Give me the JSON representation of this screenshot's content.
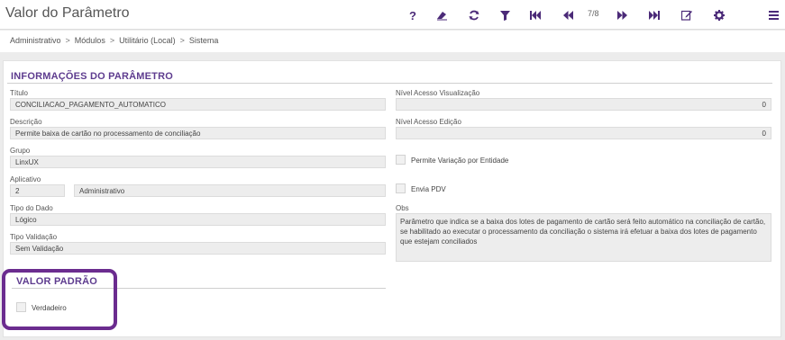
{
  "header": {
    "title": "Valor do Parâmetro",
    "record_counter": "7/8",
    "toolbar": [
      {
        "name": "help-button",
        "icon": "?"
      },
      {
        "name": "clear-button",
        "icon": "eraser-icon"
      },
      {
        "name": "refresh-button",
        "icon": "refresh-icon"
      },
      {
        "name": "filter-button",
        "icon": "filter-icon"
      },
      {
        "name": "first-record-button",
        "icon": "first-icon"
      },
      {
        "name": "previous-record-button",
        "icon": "previous-icon"
      },
      {
        "name": "next-record-button",
        "icon": "next-icon"
      },
      {
        "name": "last-record-button",
        "icon": "last-icon"
      },
      {
        "name": "edit-button",
        "icon": "edit-icon"
      },
      {
        "name": "settings-button",
        "icon": "gear-icon"
      },
      {
        "name": "menu-button",
        "icon": "hamburger-icon"
      }
    ]
  },
  "breadcrumb": [
    "Administrativo",
    "Módulos",
    "Utilitário (Local)",
    "Sistema"
  ],
  "breadcrumb_sep": ">",
  "info_section": {
    "title": "INFORMAÇÕES DO PARÂMETRO",
    "titulo": {
      "label": "Título",
      "value": "CONCILIACAO_PAGAMENTO_AUTOMATICO"
    },
    "descricao": {
      "label": "Descrição",
      "value": "Permite baixa de cartão no processamento de conciliação"
    },
    "grupo": {
      "label": "Grupo",
      "value": "LinxUX"
    },
    "aplicativo": {
      "label": "Aplicativo",
      "code": "2",
      "name": "Administrativo"
    },
    "tipo_dado": {
      "label": "Tipo do Dado",
      "value": "Lógico"
    },
    "tipo_validacao": {
      "label": "Tipo Validação",
      "value": "Sem Validação"
    },
    "nivel_acesso_visualizacao": {
      "label": "Nível Acesso Visualização",
      "value": "0"
    },
    "nivel_acesso_edicao": {
      "label": "Nível Acesso Edição",
      "value": "0"
    },
    "permite_variacao": {
      "label": "Permite Variação por Entidade",
      "checked": false
    },
    "envia_pdv": {
      "label": "Envia PDV",
      "checked": false
    },
    "obs": {
      "label": "Obs",
      "value": "Parâmetro que indica se a baixa dos lotes de pagamento de cartão será feito automático na conciliação de cartão, se habilitado ao executar o processamento da conciliação o sistema irá efetuar a baixa dos lotes de pagamento que estejam conciliados"
    }
  },
  "default_section": {
    "title": "VALOR PADRÃO",
    "verdadeiro": {
      "label": "Verdadeiro",
      "checked": false
    }
  },
  "colors": {
    "accent": "#5e3c8f",
    "highlight": "#6b2c8f",
    "field_bg": "#ededed"
  }
}
